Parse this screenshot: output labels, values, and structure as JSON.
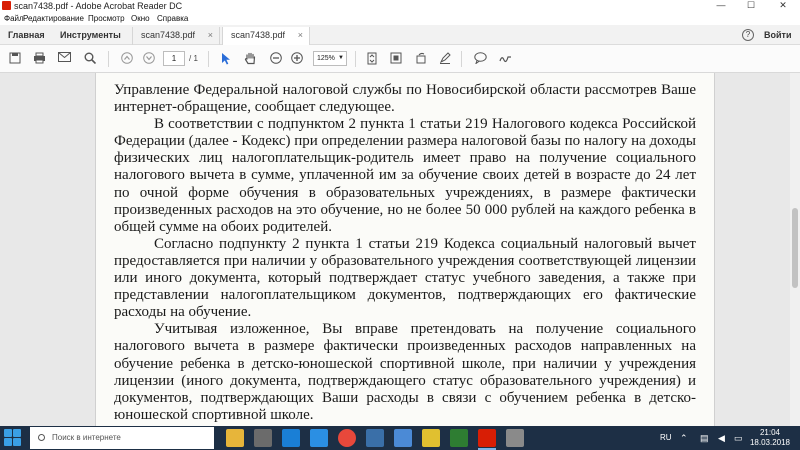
{
  "window": {
    "title": "scan7438.pdf - Adobe Acrobat Reader DC",
    "minimize_glyph": "—",
    "maximize_glyph": "☐",
    "close_glyph": "✕"
  },
  "menu": {
    "items": [
      "Файл",
      "Редактирование",
      "Просмотр",
      "Окно",
      "Справка"
    ]
  },
  "tabs": {
    "home": "Главная",
    "tools": "Инструменты",
    "docs": [
      {
        "label": "scan7438.pdf",
        "close": "×"
      },
      {
        "label": "scan7438.pdf",
        "close": "×"
      }
    ],
    "help": "?",
    "login": "Войти"
  },
  "toolbar": {
    "page_current": "1",
    "page_total": "/ 1",
    "zoom": "125%",
    "zoom_caret": "▼"
  },
  "document": {
    "paragraphs": [
      "Управление Федеральной налоговой службы по Новосибирской области рассмотрев Ваше интернет-обращение, сообщает следующее.",
      "В соответствии с подпунктом 2 пункта 1 статьи 219 Налогового кодекса Российской Федерации (далее - Кодекс) при определении размера налоговой базы по налогу на доходы физических лиц налогоплательщик-родитель имеет право на получение социального налогового вычета в сумме, уплаченной им за обучение своих детей в возрасте до 24 лет по очной форме обучения в образовательных учреждениях, в размере фактически произведенных расходов на это обучение, но не более 50 000 рублей на каждого ребенка в общей сумме на обоих родителей.",
      "Согласно подпункту 2 пункта 1 статьи 219 Кодекса социальный налоговый вычет предоставляется при наличии у образовательного учреждения соответствующей лицензии или иного документа, который подтверждает статус учебного заведения, а также при представлении налогоплательщиком документов, подтверждающих его фактические расходы на обучение.",
      "Учитывая изложенное, Вы вправе претендовать на получение социального налогового вычета в размере фактически произведенных расходов направленных на обучение ребенка в детско-юношеской спортивной школе, при наличии у учреждения лицензии (иного документа, подтверждающего статус образовательного учреждения) и документов, подтверждающих Ваши расходы в связи с обучением ребенка в детско-юношеской спортивной школе."
    ]
  },
  "taskbar": {
    "search_placeholder": "Поиск в интернете",
    "language": "RU",
    "time": "21:04",
    "date": "18.03.2018"
  },
  "colors": {
    "acrobat_red": "#d81e05",
    "taskbar_bg": "#1d2f45",
    "accent_blue": "#2a6dd8"
  }
}
